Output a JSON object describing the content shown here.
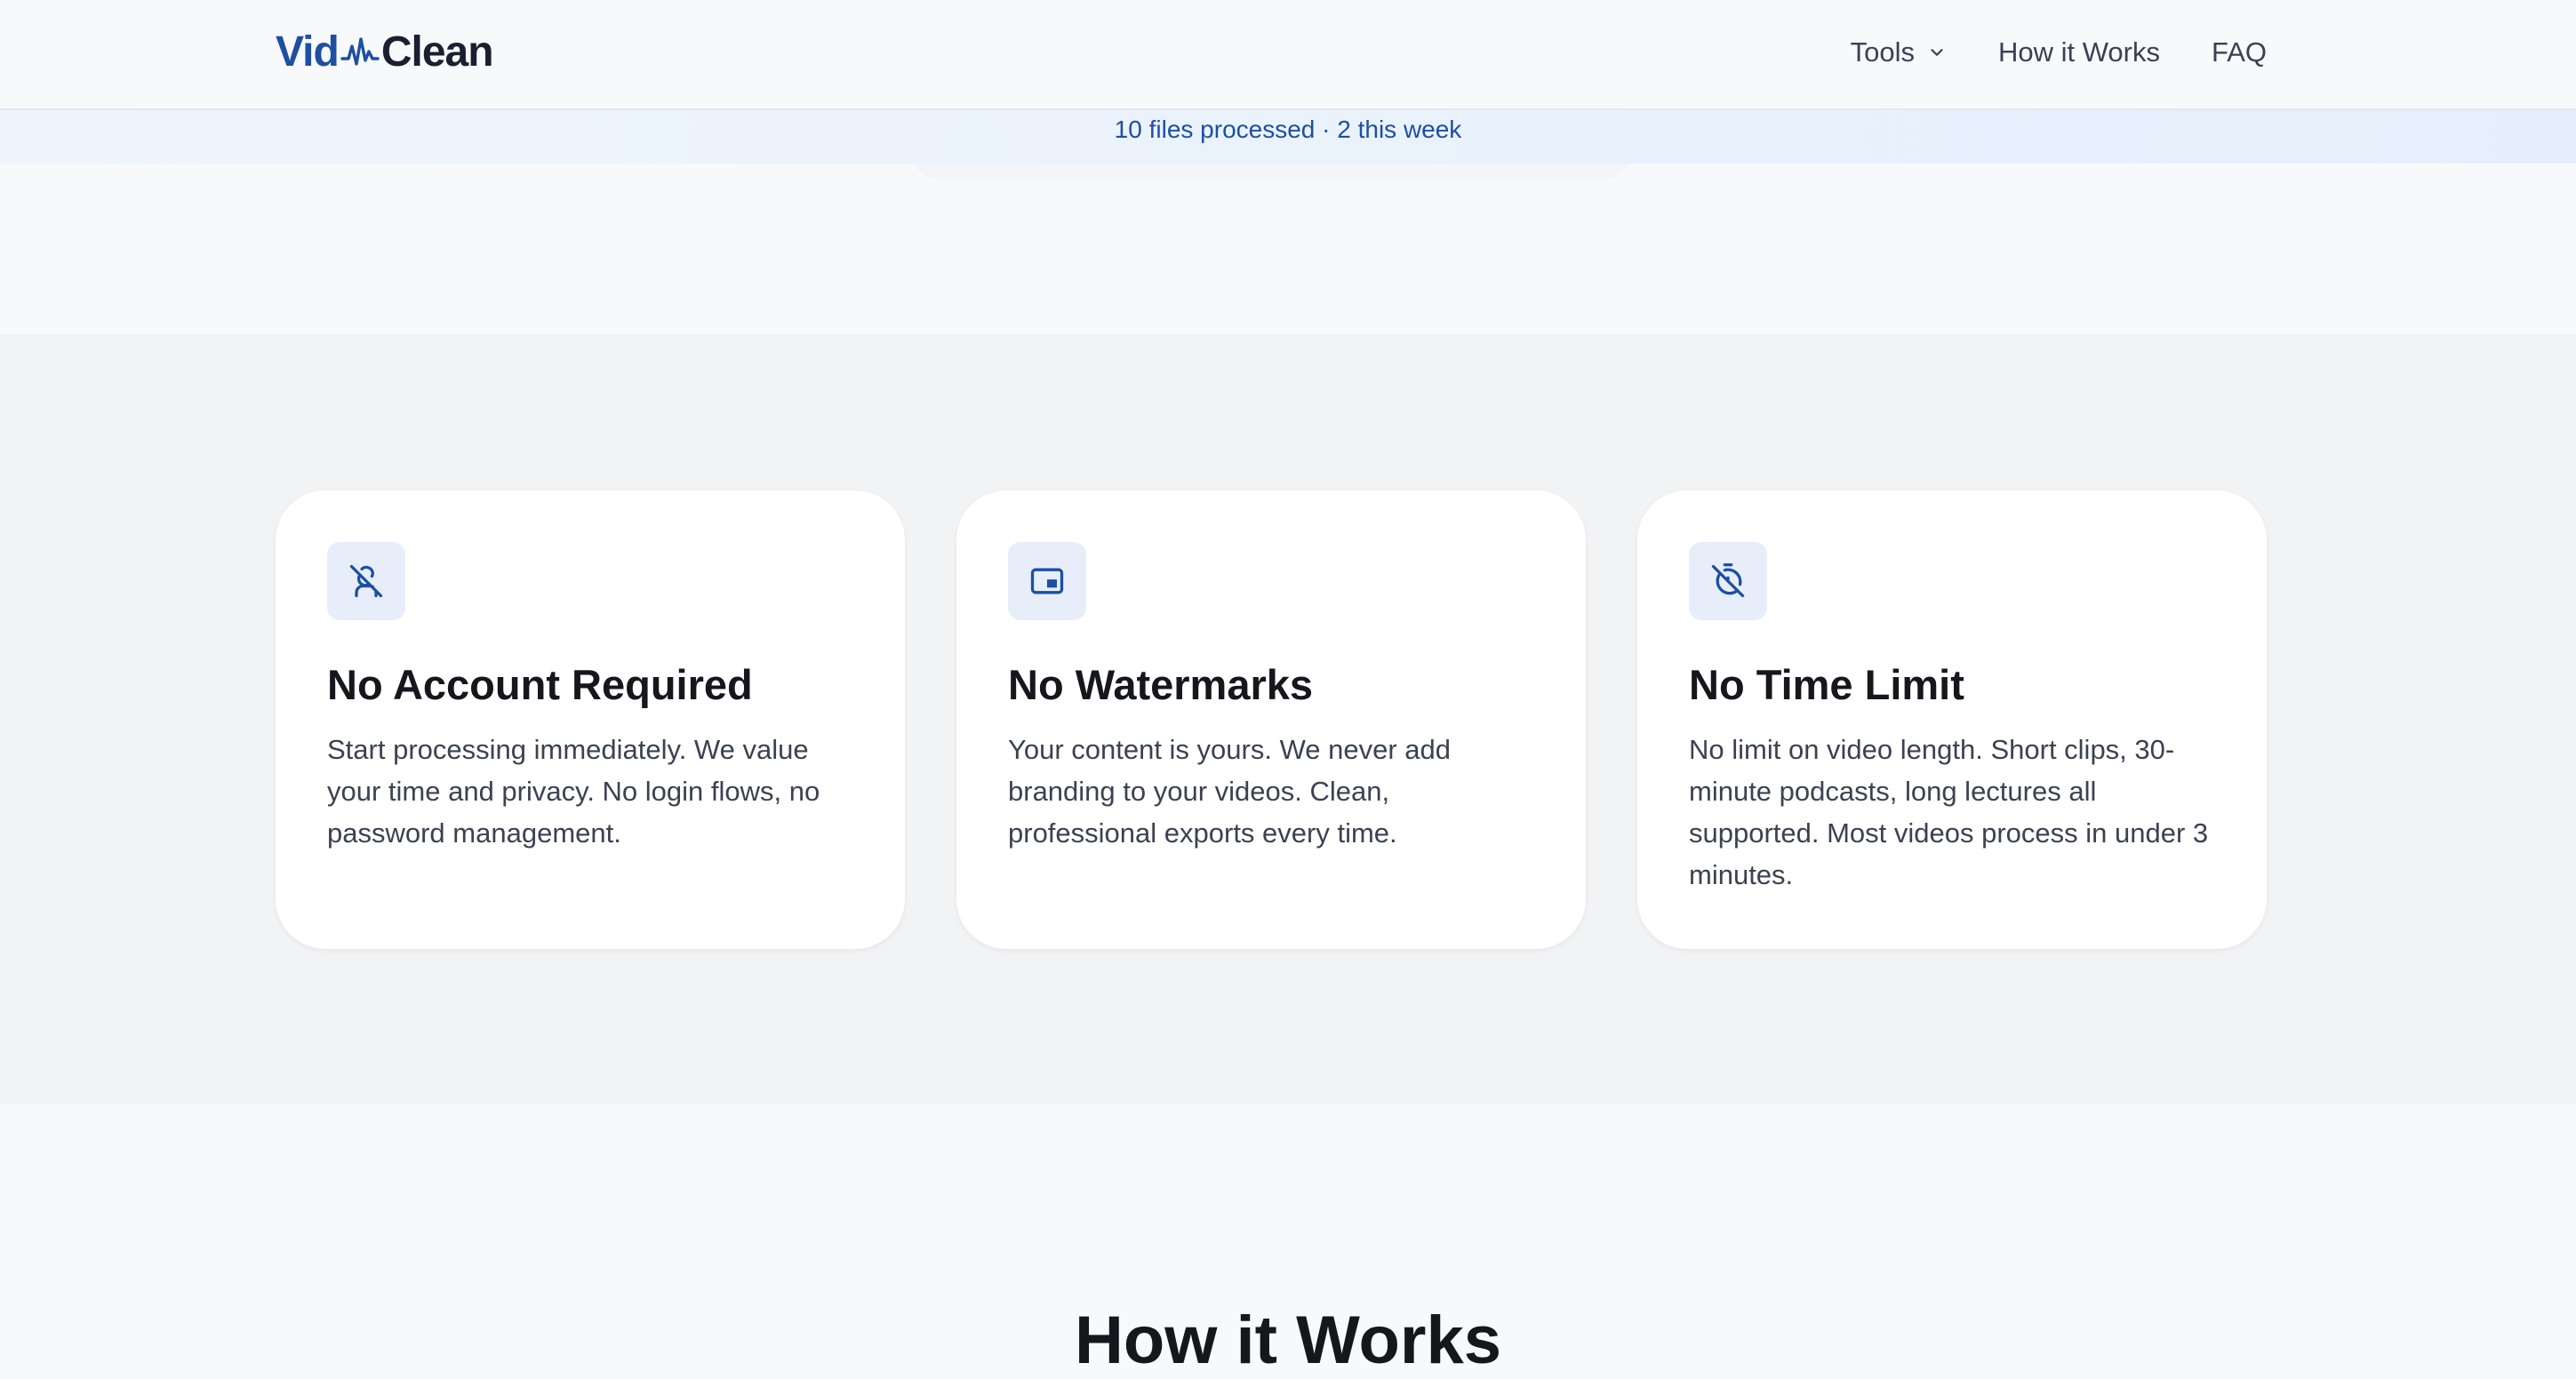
{
  "header": {
    "logo": {
      "part1": "Vid",
      "part2": "Clean"
    },
    "nav": [
      {
        "label": "Tools"
      },
      {
        "label": "How it Works"
      },
      {
        "label": "FAQ"
      }
    ]
  },
  "stats": {
    "text": "10 files processed · 2 this week"
  },
  "features": [
    {
      "icon": "user-off-icon",
      "title": "No Account Required",
      "description": "Start processing immediately. We value your time and privacy. No login flows, no password management."
    },
    {
      "icon": "picture-in-picture-icon",
      "title": "No Watermarks",
      "description": "Your content is yours. We never add branding to your videos. Clean, professional exports every time."
    },
    {
      "icon": "timer-off-icon",
      "title": "No Time Limit",
      "description": "No limit on video length. Short clips, 30-minute podcasts, long lectures all supported. Most videos process in under 3 minutes."
    }
  ],
  "howit": {
    "title": "How it Works"
  },
  "colors": {
    "brand": "#1d4fa3",
    "dark": "#1a2030"
  }
}
